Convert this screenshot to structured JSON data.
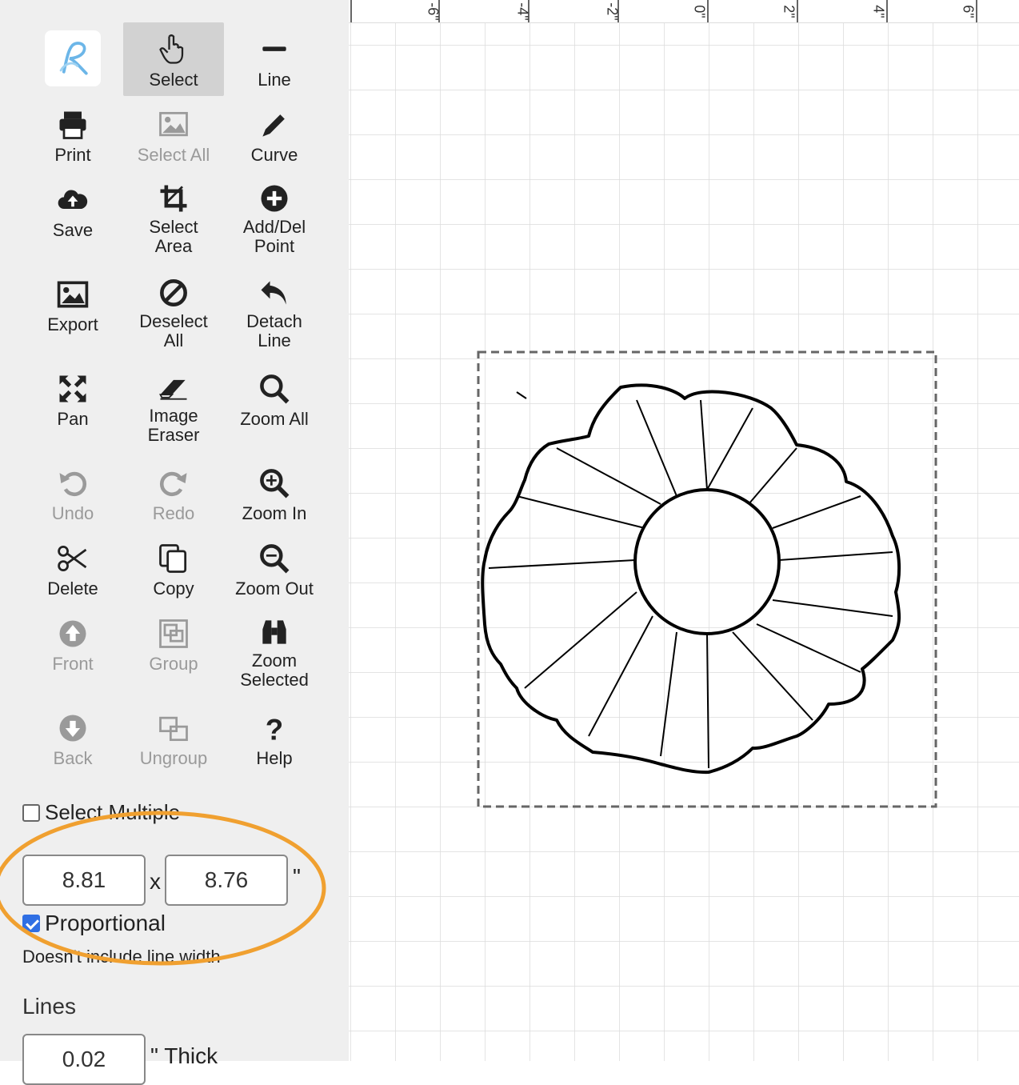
{
  "tools": [
    {
      "label": "Select",
      "icon": "pointer-hand-icon",
      "state": "active"
    },
    {
      "label": "Line",
      "icon": "line-icon",
      "state": "normal"
    },
    {
      "label": "Print",
      "icon": "printer-icon",
      "state": "normal"
    },
    {
      "label": "Select All",
      "icon": "image-icon",
      "state": "disabled"
    },
    {
      "label": "Curve",
      "icon": "pencil-icon",
      "state": "normal"
    },
    {
      "label": "Save",
      "icon": "cloud-upload-icon",
      "state": "normal"
    },
    {
      "label": "Select Area",
      "icon": "crop-icon",
      "state": "normal"
    },
    {
      "label": "Add/Del Point",
      "icon": "plus-circle-icon",
      "state": "normal"
    },
    {
      "label": "Export",
      "icon": "picture-icon",
      "state": "normal"
    },
    {
      "label": "Deselect All",
      "icon": "ban-icon",
      "state": "normal"
    },
    {
      "label": "Detach Line",
      "icon": "reply-arrow-icon",
      "state": "normal"
    },
    {
      "label": "Pan",
      "icon": "arrows-expand-icon",
      "state": "normal"
    },
    {
      "label": "Image Eraser",
      "icon": "eraser-icon",
      "state": "normal"
    },
    {
      "label": "Zoom All",
      "icon": "magnifier-icon",
      "state": "normal"
    },
    {
      "label": "Undo",
      "icon": "undo-icon",
      "state": "disabled"
    },
    {
      "label": "Redo",
      "icon": "redo-icon",
      "state": "disabled"
    },
    {
      "label": "Zoom In",
      "icon": "zoom-in-icon",
      "state": "normal"
    },
    {
      "label": "Delete",
      "icon": "scissors-icon",
      "state": "normal"
    },
    {
      "label": "Copy",
      "icon": "copy-icon",
      "state": "normal"
    },
    {
      "label": "Zoom Out",
      "icon": "zoom-out-icon",
      "state": "normal"
    },
    {
      "label": "Front",
      "icon": "arrow-up-circle-icon",
      "state": "disabled"
    },
    {
      "label": "Group",
      "icon": "group-icon",
      "state": "disabled"
    },
    {
      "label": "Zoom Selected",
      "icon": "binoculars-icon",
      "state": "normal"
    },
    {
      "label": "Back",
      "icon": "arrow-down-circle-icon",
      "state": "disabled"
    },
    {
      "label": "Ungroup",
      "icon": "ungroup-icon",
      "state": "disabled"
    },
    {
      "label": "Help",
      "icon": "question-icon",
      "state": "normal"
    }
  ],
  "options": {
    "select_multiple": "Select Multiple",
    "select_multiple_checked": false,
    "width": "8.81",
    "height": "8.76",
    "times": "x",
    "unit": "\"",
    "proportional": "Proportional",
    "proportional_checked": true,
    "note": "Doesn't include line width",
    "lines_title": "Lines",
    "thickness": "0.02",
    "thick_label": "\" Thick"
  },
  "ruler": {
    "labels": [
      "-6\"",
      "-4\"",
      "-2\"",
      "0\"",
      "2\"",
      "4\"",
      "6\""
    ]
  },
  "colors": {
    "accent_highlight": "#f0a030",
    "checkbox_blue": "#2f6fe4"
  }
}
